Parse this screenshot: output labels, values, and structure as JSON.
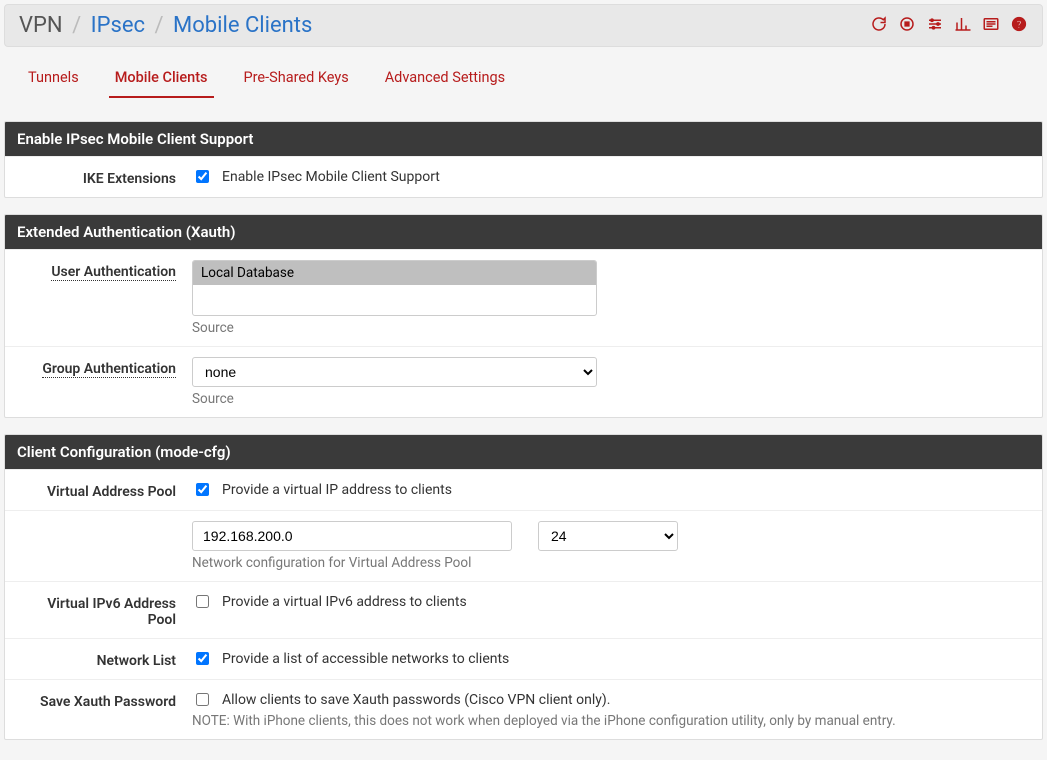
{
  "breadcrumb": {
    "root": "VPN",
    "mid": "IPsec",
    "leaf": "Mobile Clients"
  },
  "tabs": {
    "tunnels": "Tunnels",
    "mobile": "Mobile Clients",
    "psk": "Pre-Shared Keys",
    "advanced": "Advanced Settings"
  },
  "panel1": {
    "title": "Enable IPsec Mobile Client Support",
    "ike_label": "IKE Extensions",
    "ike_text": "Enable IPsec Mobile Client Support"
  },
  "panel2": {
    "title": "Extended Authentication (Xauth)",
    "user_auth_label": "User Authentication",
    "user_auth_option": "Local Database",
    "source_text": "Source",
    "group_auth_label": "Group Authentication",
    "group_auth_value": "none"
  },
  "panel3": {
    "title": "Client Configuration (mode-cfg)",
    "vap_label": "Virtual Address Pool",
    "vap_text": "Provide a virtual IP address to clients",
    "vap_network": "192.168.200.0",
    "vap_prefix": "24",
    "vap_help": "Network configuration for Virtual Address Pool",
    "v6_label": "Virtual IPv6 Address Pool",
    "v6_text": "Provide a virtual IPv6 address to clients",
    "netlist_label": "Network List",
    "netlist_text": "Provide a list of accessible networks to clients",
    "save_xauth_label": "Save Xauth Password",
    "save_xauth_text": "Allow clients to save Xauth passwords (Cisco VPN client only).",
    "save_xauth_note": "NOTE: With iPhone clients, this does not work when deployed via the iPhone configuration utility, only by manual entry."
  }
}
